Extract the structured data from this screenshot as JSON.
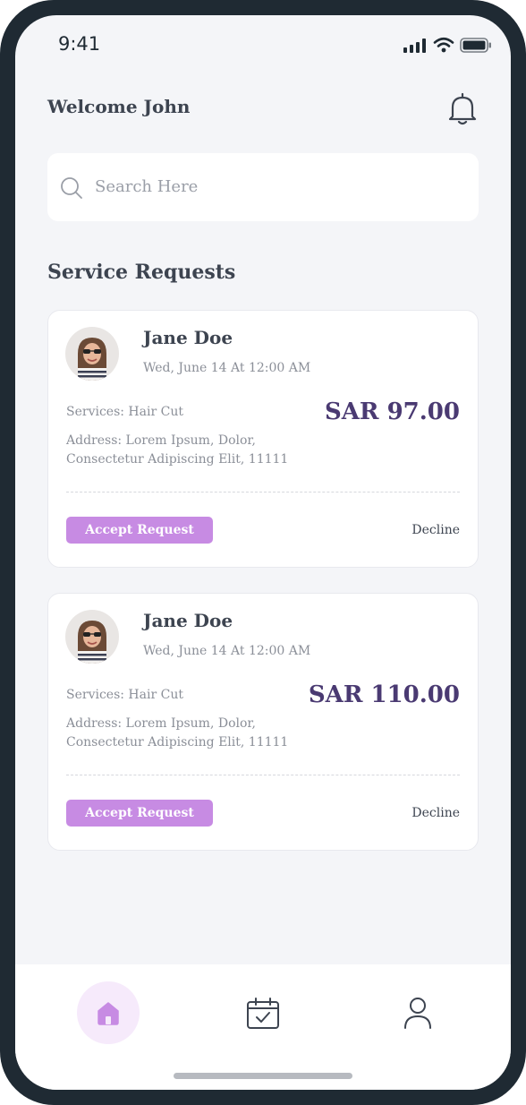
{
  "status_bar": {
    "time": "9:41"
  },
  "header": {
    "welcome": "Welcome John",
    "icon": "bell-icon"
  },
  "search": {
    "placeholder": "Search Here",
    "icon": "search-icon"
  },
  "section": {
    "title": "Service Requests"
  },
  "requests": [
    {
      "name": "Jane Doe",
      "datetime": "Wed, June 14 At 12:00 AM",
      "services": "Services: Hair Cut",
      "price": "SAR 97.00",
      "address": "Address: Lorem Ipsum, Dolor, Consectetur Adipiscing Elit, 11111",
      "accept_label": "Accept Request",
      "decline_label": "Decline"
    },
    {
      "name": "Jane Doe",
      "datetime": "Wed, June 14 At 12:00 AM",
      "services": "Services: Hair Cut",
      "price": "SAR 110.00",
      "address": "Address: Lorem Ipsum, Dolor, Consectetur Adipiscing Elit, 11111",
      "accept_label": "Accept Request",
      "decline_label": "Decline"
    }
  ],
  "bottom_nav": [
    {
      "icon": "home-icon",
      "active": true
    },
    {
      "icon": "calendar-check-icon",
      "active": false
    },
    {
      "icon": "user-icon",
      "active": false
    }
  ],
  "colors": {
    "accent": "#c78be3",
    "price": "#4a3a72",
    "background": "#f4f5f8",
    "frame": "#1f2a33"
  }
}
